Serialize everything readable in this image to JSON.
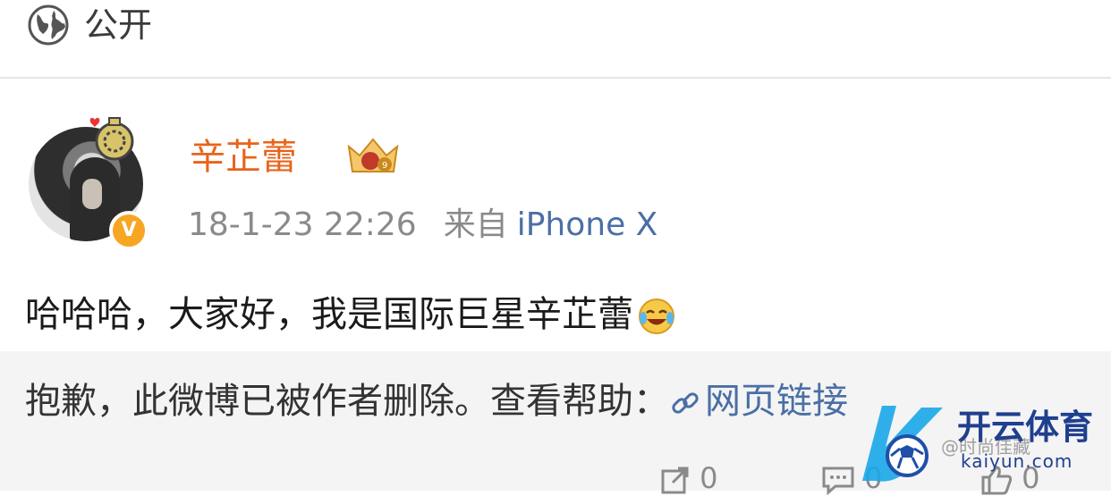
{
  "header": {
    "visibility_icon": "globe-icon",
    "visibility_label": "公开"
  },
  "post": {
    "username": "辛芷蕾",
    "member_badge_icon": "vip-crown-badge-icon",
    "verified_icon": "verified-v-icon",
    "verified_text": "V",
    "timestamp": "18-1-23 22:26",
    "source_prefix": "来自",
    "source_device": "iPhone X",
    "text": "哈哈哈，大家好，我是国际巨星辛芷蕾",
    "emoji": "laugh-cry-emoji-icon"
  },
  "repost": {
    "deleted_text": "抱歉，此微博已被作者删除。查看帮助：",
    "help_link_icon": "link-icon",
    "help_link_label": "网页链接"
  },
  "actions": {
    "repost_icon": "share-icon",
    "repost_count": "0",
    "comment_icon": "comment-icon",
    "comment_count": "0",
    "like_icon": "thumbs-up-icon",
    "like_count": "0"
  },
  "watermark": {
    "brand": "开云体育",
    "domain": "kaiyun.com",
    "handle": "@时尚佳藏"
  },
  "colors": {
    "username": "#e8641a",
    "link": "#4a6fa5",
    "meta": "#8a8a8a",
    "repost_bg": "#f4f4f4",
    "verified": "#f6a623",
    "watermark": "#1f3f8f"
  }
}
